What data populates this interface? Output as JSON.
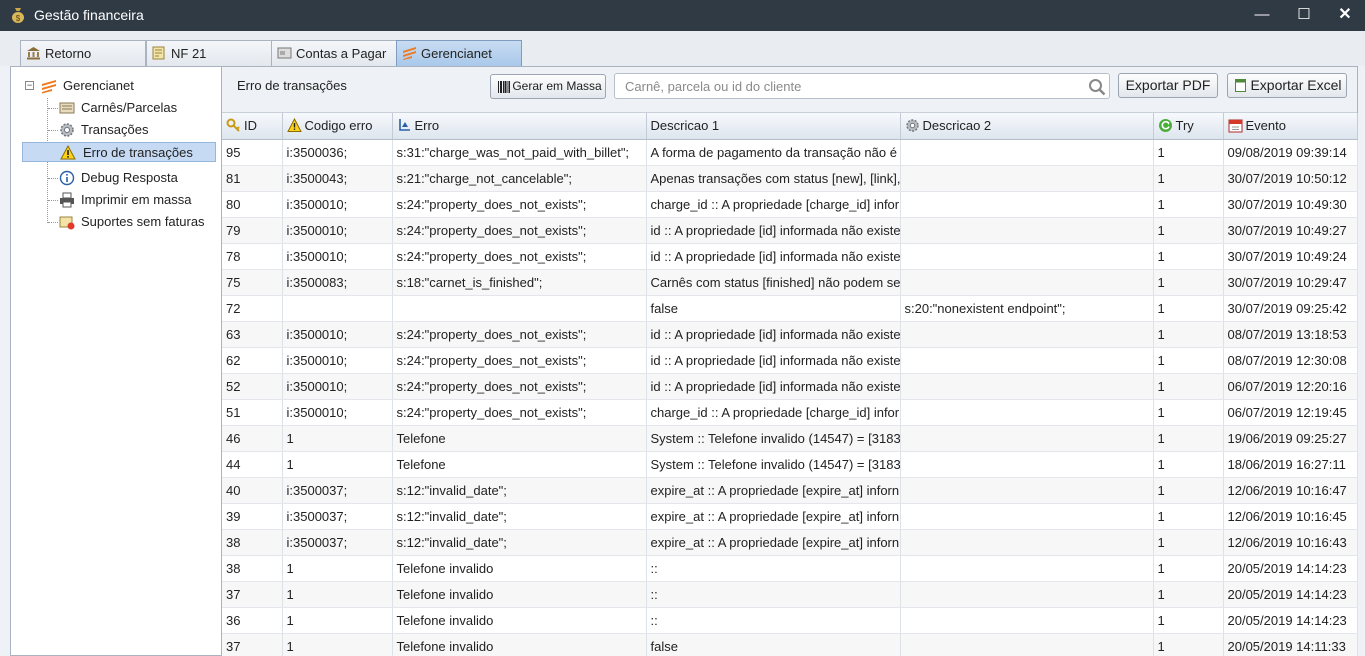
{
  "window": {
    "title": "Gestão financeira",
    "minimize_symbol": "—",
    "maximize_symbol": "☐",
    "close_symbol": "✕"
  },
  "tabs": [
    {
      "label": "Retorno",
      "icon": "bank-icon"
    },
    {
      "label": "NF 21",
      "icon": "invoice-icon"
    },
    {
      "label": "Contas a Pagar",
      "icon": "card-icon"
    },
    {
      "label": "Gerencianet",
      "icon": "gerencianet-logo-icon",
      "active": true
    }
  ],
  "tree": {
    "root": {
      "label": "Gerencianet",
      "collapse_symbol": "−"
    },
    "items": [
      {
        "label": "Carnês/Parcelas",
        "icon": "carne-icon"
      },
      {
        "label": "Transações",
        "icon": "gear-icon"
      },
      {
        "label": "Erro de transações",
        "icon": "warning-icon",
        "selected": true
      },
      {
        "label": "Debug Resposta",
        "icon": "info-icon"
      },
      {
        "label": "Imprimir em massa",
        "icon": "printer-icon"
      },
      {
        "label": "Suportes sem faturas",
        "icon": "support-icon"
      }
    ]
  },
  "toolbar": {
    "title": "Erro de transações",
    "gerar_label": "Gerar em Massa",
    "search_placeholder": "Carnê, parcela ou id do cliente",
    "export_pdf_label": "Exportar PDF",
    "export_excel_label": "Exportar Excel"
  },
  "columns": [
    "ID",
    "Codigo erro",
    "Erro",
    "Descricao 1",
    "Descricao 2",
    "Try",
    "Evento"
  ],
  "rows": [
    [
      "95",
      "i:3500036;",
      "s:31:\"charge_was_not_paid_with_billet\";",
      "A forma de pagamento da transação não é",
      "",
      "1",
      "09/08/2019 09:39:14"
    ],
    [
      "81",
      "i:3500043;",
      "s:21:\"charge_not_cancelable\";",
      "Apenas transações com status [new], [link],",
      "",
      "1",
      "30/07/2019 10:50:12"
    ],
    [
      "80",
      "i:3500010;",
      "s:24:\"property_does_not_exists\";",
      "charge_id :: A propriedade [charge_id] infor",
      "",
      "1",
      "30/07/2019 10:49:30"
    ],
    [
      "79",
      "i:3500010;",
      "s:24:\"property_does_not_exists\";",
      "id :: A propriedade [id] informada não existe",
      "",
      "1",
      "30/07/2019 10:49:27"
    ],
    [
      "78",
      "i:3500010;",
      "s:24:\"property_does_not_exists\";",
      "id :: A propriedade [id] informada não existe",
      "",
      "1",
      "30/07/2019 10:49:24"
    ],
    [
      "75",
      "i:3500083;",
      "s:18:\"carnet_is_finished\";",
      "Carnês com status [finished] não podem se",
      "",
      "1",
      "30/07/2019 10:29:47"
    ],
    [
      "72",
      "",
      "",
      "false",
      "s:20:\"nonexistent endpoint\";",
      "1",
      "30/07/2019 09:25:42"
    ],
    [
      "63",
      "i:3500010;",
      "s:24:\"property_does_not_exists\";",
      "id :: A propriedade [id] informada não existe",
      "",
      "1",
      "08/07/2019 13:18:53"
    ],
    [
      "62",
      "i:3500010;",
      "s:24:\"property_does_not_exists\";",
      "id :: A propriedade [id] informada não existe",
      "",
      "1",
      "08/07/2019 12:30:08"
    ],
    [
      "52",
      "i:3500010;",
      "s:24:\"property_does_not_exists\";",
      "id :: A propriedade [id] informada não existe",
      "",
      "1",
      "06/07/2019 12:20:16"
    ],
    [
      "51",
      "i:3500010;",
      "s:24:\"property_does_not_exists\";",
      "charge_id :: A propriedade [charge_id] infor",
      "",
      "1",
      "06/07/2019 12:19:45"
    ],
    [
      "46",
      "1",
      "Telefone",
      "System :: Telefone invalido (14547) = [3183",
      "",
      "1",
      "19/06/2019 09:25:27"
    ],
    [
      "44",
      "1",
      "Telefone",
      "System :: Telefone invalido (14547) = [3183",
      "",
      "1",
      "18/06/2019 16:27:11"
    ],
    [
      "40",
      "i:3500037;",
      "s:12:\"invalid_date\";",
      "expire_at :: A propriedade [expire_at] inforn",
      "",
      "1",
      "12/06/2019 10:16:47"
    ],
    [
      "39",
      "i:3500037;",
      "s:12:\"invalid_date\";",
      "expire_at :: A propriedade [expire_at] inforn",
      "",
      "1",
      "12/06/2019 10:16:45"
    ],
    [
      "38",
      "i:3500037;",
      "s:12:\"invalid_date\";",
      "expire_at :: A propriedade [expire_at] inforn",
      "",
      "1",
      "12/06/2019 10:16:43"
    ],
    [
      "38",
      "1",
      "Telefone invalido",
      "::",
      "",
      "1",
      "20/05/2019 14:14:23"
    ],
    [
      "37",
      "1",
      "Telefone invalido",
      "::",
      "",
      "1",
      "20/05/2019 14:14:23"
    ],
    [
      "36",
      "1",
      "Telefone invalido",
      "::",
      "",
      "1",
      "20/05/2019 14:14:23"
    ],
    [
      "37",
      "1",
      "Telefone invalido",
      "false",
      "",
      "1",
      "20/05/2019 14:11:33"
    ]
  ],
  "colors": {
    "titlebar": "#303a45",
    "selection": "#c6daf3",
    "active_tab": "#a9c8ea",
    "accent_orange": "#f07a1e"
  }
}
